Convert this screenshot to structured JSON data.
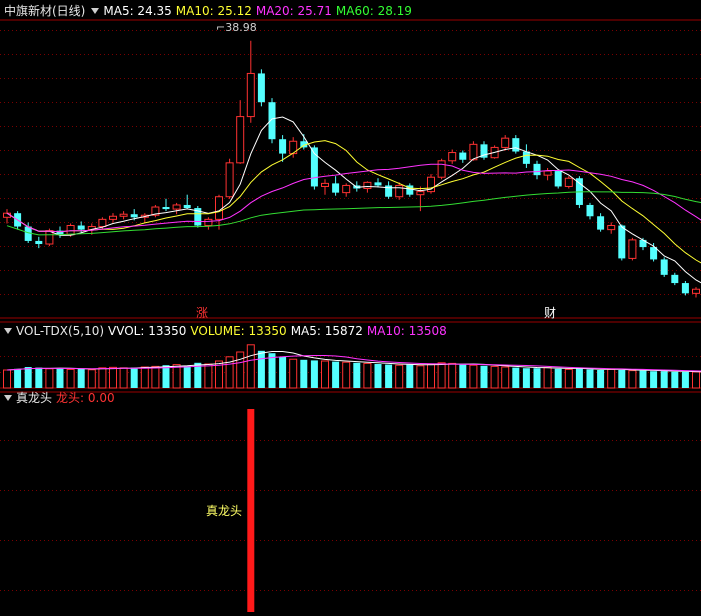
{
  "main": {
    "title": "中旗新材(日线)",
    "ma": [
      {
        "label": "MA5: 24.35",
        "color": "#ffffff"
      },
      {
        "label": "MA10: 25.12",
        "color": "#ffff33"
      },
      {
        "label": "MA20: 25.71",
        "color": "#ff33ff"
      },
      {
        "label": "MA60: 28.19",
        "color": "#33ff33"
      }
    ],
    "max_label": "38.98",
    "events": [
      {
        "text": "涨",
        "color": "#ff3333"
      },
      {
        "text": "财",
        "color": "#ffffff"
      }
    ]
  },
  "volume": {
    "name": "VOL-TDX(5,10)",
    "items": [
      {
        "label": "VVOL: 13350",
        "color": "#ffffff"
      },
      {
        "label": "VOLUME: 13350",
        "color": "#ffff33"
      },
      {
        "label": "MA5: 15872",
        "color": "#ffffff"
      },
      {
        "label": "MA10: 13508",
        "color": "#ff33ff"
      }
    ]
  },
  "signal": {
    "name": "真龙头",
    "value_label": "龙头: 0.00",
    "bar_label": "真龙头"
  },
  "colors": {
    "up": "#ff3232",
    "down": "#54ffff",
    "grid": "#7a0000",
    "ma5": "#ffffff",
    "ma10": "#ffff33",
    "ma20": "#ff33ff",
    "ma60": "#33dd33"
  },
  "chart_data": {
    "type": "candlestick",
    "title": "中旗新材(日线)",
    "ohlc": [
      [
        21.8,
        22.6,
        21.2,
        22.2
      ],
      [
        22.2,
        22.4,
        20.6,
        20.9
      ],
      [
        20.9,
        21.3,
        19.3,
        19.5
      ],
      [
        19.5,
        19.9,
        18.8,
        19.2
      ],
      [
        19.2,
        20.7,
        19.0,
        20.5
      ],
      [
        20.5,
        20.9,
        19.8,
        20.1
      ],
      [
        20.1,
        21.2,
        19.9,
        21.0
      ],
      [
        21.0,
        21.4,
        20.3,
        20.6
      ],
      [
        20.6,
        21.2,
        20.1,
        20.9
      ],
      [
        20.9,
        21.8,
        20.7,
        21.6
      ],
      [
        21.6,
        22.2,
        21.3,
        21.9
      ],
      [
        21.9,
        22.4,
        21.6,
        22.1
      ],
      [
        22.1,
        22.6,
        21.5,
        21.8
      ],
      [
        21.8,
        22.2,
        21.3,
        22.0
      ],
      [
        22.0,
        23.0,
        21.8,
        22.8
      ],
      [
        22.8,
        23.6,
        22.4,
        22.6
      ],
      [
        22.6,
        23.2,
        22.1,
        23.0
      ],
      [
        23.0,
        24.0,
        22.6,
        22.7
      ],
      [
        22.7,
        22.9,
        20.8,
        21.0
      ],
      [
        21.0,
        21.8,
        20.6,
        21.6
      ],
      [
        21.6,
        24.0,
        20.6,
        23.8
      ],
      [
        23.8,
        27.5,
        23.6,
        27.1
      ],
      [
        27.1,
        33.2,
        27.0,
        31.6
      ],
      [
        31.6,
        38.98,
        31.0,
        35.8
      ],
      [
        35.8,
        36.2,
        32.6,
        33.0
      ],
      [
        33.0,
        33.4,
        29.0,
        29.4
      ],
      [
        29.4,
        29.8,
        27.2,
        28.0
      ],
      [
        28.0,
        29.6,
        27.6,
        29.2
      ],
      [
        29.2,
        29.9,
        28.4,
        28.6
      ],
      [
        28.6,
        28.8,
        24.5,
        24.8
      ],
      [
        24.8,
        25.5,
        24.0,
        25.1
      ],
      [
        25.1,
        25.8,
        23.9,
        24.2
      ],
      [
        24.2,
        25.1,
        23.8,
        24.9
      ],
      [
        24.9,
        25.3,
        24.3,
        24.6
      ],
      [
        24.6,
        25.3,
        24.2,
        25.2
      ],
      [
        25.2,
        25.6,
        24.7,
        24.9
      ],
      [
        24.9,
        25.3,
        23.6,
        23.8
      ],
      [
        23.8,
        25.2,
        23.5,
        24.9
      ],
      [
        24.9,
        25.1,
        23.8,
        24.0
      ],
      [
        24.0,
        24.8,
        22.4,
        24.3
      ],
      [
        24.3,
        26.0,
        24.1,
        25.7
      ],
      [
        25.7,
        27.5,
        25.5,
        27.3
      ],
      [
        27.3,
        28.4,
        27.0,
        28.1
      ],
      [
        28.1,
        28.3,
        27.1,
        27.4
      ],
      [
        27.4,
        29.2,
        27.3,
        28.9
      ],
      [
        28.9,
        29.2,
        27.4,
        27.6
      ],
      [
        27.6,
        28.8,
        27.5,
        28.6
      ],
      [
        28.6,
        29.8,
        28.3,
        29.5
      ],
      [
        29.5,
        29.8,
        28.0,
        28.2
      ],
      [
        28.2,
        28.9,
        26.6,
        27.0
      ],
      [
        27.0,
        27.3,
        25.5,
        25.9
      ],
      [
        25.9,
        26.6,
        25.4,
        26.3
      ],
      [
        26.3,
        26.4,
        24.6,
        24.8
      ],
      [
        24.8,
        25.8,
        24.6,
        25.6
      ],
      [
        25.6,
        25.8,
        22.7,
        23.0
      ],
      [
        23.0,
        23.2,
        21.6,
        21.9
      ],
      [
        21.9,
        22.2,
        20.4,
        20.6
      ],
      [
        20.6,
        21.3,
        20.2,
        21.0
      ],
      [
        21.0,
        21.1,
        17.6,
        17.8
      ],
      [
        17.8,
        19.8,
        17.6,
        19.6
      ],
      [
        19.6,
        19.8,
        18.6,
        18.9
      ],
      [
        18.9,
        19.3,
        17.5,
        17.7
      ],
      [
        17.7,
        17.9,
        16.0,
        16.2
      ],
      [
        16.2,
        16.4,
        15.2,
        15.4
      ],
      [
        15.4,
        15.6,
        14.2,
        14.4
      ],
      [
        14.4,
        15.0,
        14.0,
        14.8
      ],
      [
        14.8,
        15.2,
        14.5,
        14.9
      ]
    ],
    "volume": [
      15000,
      16000,
      17500,
      17000,
      16000,
      16500,
      15500,
      16000,
      15200,
      16800,
      17200,
      16800,
      17000,
      17500,
      18000,
      19000,
      19500,
      18500,
      21000,
      20000,
      22500,
      26000,
      30000,
      36000,
      31000,
      29000,
      26000,
      24000,
      23500,
      23000,
      22500,
      22000,
      21500,
      21000,
      20500,
      20000,
      19500,
      19000,
      19500,
      18500,
      20000,
      21000,
      20500,
      19500,
      19000,
      18500,
      18000,
      17500,
      17000,
      16500,
      16500,
      17000,
      16000,
      15500,
      16500,
      15500,
      15000,
      15500,
      15000,
      14500,
      14500,
      14000,
      14000,
      13500,
      13500,
      13350,
      13300
    ],
    "signal": {
      "x": 23,
      "value": 1
    },
    "events": [
      {
        "x": 23,
        "text": "涨"
      },
      {
        "x": 62,
        "text": "财"
      }
    ],
    "ylim": [
      12,
      41
    ]
  }
}
